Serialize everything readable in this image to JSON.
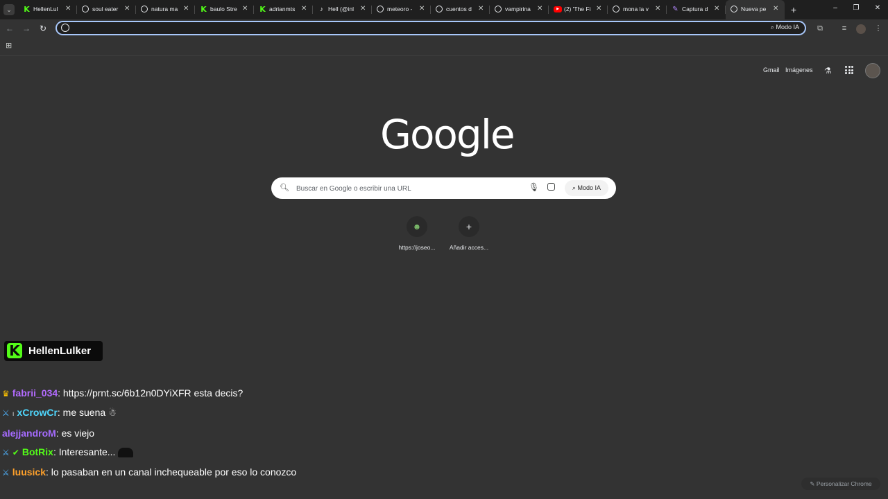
{
  "tabs": [
    {
      "title": "HellenLul",
      "favicon": "kick-icon",
      "active": false
    },
    {
      "title": "soul eater",
      "favicon": "google-icon",
      "active": false
    },
    {
      "title": "natura ma",
      "favicon": "google-icon",
      "active": false
    },
    {
      "title": "baulo Stre",
      "favicon": "kick-icon",
      "active": false
    },
    {
      "title": "adrianmts",
      "favicon": "kick-icon",
      "active": false
    },
    {
      "title": "Hell (@inl",
      "favicon": "tiktok-icon",
      "active": false
    },
    {
      "title": "meteoro -",
      "favicon": "google-icon",
      "active": false
    },
    {
      "title": "cuentos d",
      "favicon": "google-icon",
      "active": false
    },
    {
      "title": "vampirina",
      "favicon": "google-icon",
      "active": false
    },
    {
      "title": "(2) 'The Fi",
      "favicon": "youtube-icon",
      "active": false
    },
    {
      "title": "mona la v",
      "favicon": "google-icon",
      "active": false
    },
    {
      "title": "Captura d",
      "favicon": "pen-icon",
      "active": false
    },
    {
      "title": "Nueva pe",
      "favicon": "chrome-icon",
      "active": true
    }
  ],
  "toolbar": {
    "omnibox_value": "",
    "ai_mode_label": "Modo IA"
  },
  "ntp": {
    "gmail": "Gmail",
    "images": "Imágenes",
    "logo": "Google",
    "search_placeholder": "Buscar en Google o escribir una URL",
    "ai_mode_label": "Modo IA",
    "shortcuts": [
      {
        "label": "https://joseo...",
        "icon": "site-favicon-icon"
      },
      {
        "label": "Añadir acces...",
        "icon": "plus-icon"
      }
    ],
    "customize_label": "Personalizar Chrome"
  },
  "overlay": {
    "channel": "HellenLulker",
    "chat": [
      {
        "badges": [
          "crown"
        ],
        "user": "fabrii_034",
        "user_color": "#b36bff",
        "message": ": https://prnt.sc/6b12n0DYiXFR esta decis?"
      },
      {
        "badges": [
          "sword",
          "small"
        ],
        "user": "xCrowCr",
        "user_color": "#4fd8ff",
        "message": ": me suena",
        "emote": true
      },
      {
        "badges": [],
        "user": "alejjandroM",
        "user_color": "#a66bff",
        "message": ": es viejo"
      },
      {
        "badges": [
          "sword",
          "verified"
        ],
        "user": "BotRix",
        "user_color": "#53fc18",
        "message": ": Interesante...",
        "emote": true
      },
      {
        "badges": [
          "sword"
        ],
        "user": "luusick",
        "user_color": "#ffa12b",
        "message": ": lo pasaban en un canal inchequeable por eso lo conozco"
      }
    ]
  },
  "colors": {
    "kick_green": "#53fc18",
    "omnibox_border": "#a8c7fa",
    "page_bg": "#333333"
  }
}
